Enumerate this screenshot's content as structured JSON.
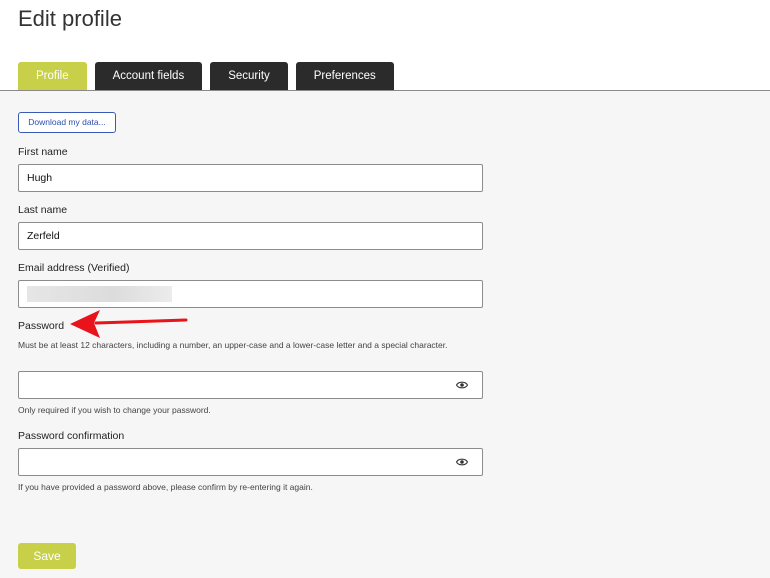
{
  "page": {
    "title": "Edit profile"
  },
  "tabs": [
    {
      "label": "Profile",
      "active": true
    },
    {
      "label": "Account fields",
      "active": false
    },
    {
      "label": "Security",
      "active": false
    },
    {
      "label": "Preferences",
      "active": false
    }
  ],
  "download_button": {
    "label": "Download my data..."
  },
  "fields": {
    "first_name": {
      "label": "First name",
      "value": "Hugh"
    },
    "last_name": {
      "label": "Last name",
      "value": "Zerfeld"
    },
    "email": {
      "label": "Email address (Verified)",
      "value": ""
    },
    "password": {
      "label": "Password",
      "requirements": "Must be at least 12 characters, including a number, an upper-case and a lower-case letter and a special character.",
      "value": "",
      "help": "Only required if you wish to change your password."
    },
    "password_confirmation": {
      "label": "Password confirmation",
      "value": "",
      "help": "If you have provided a password above, please confirm by re-entering it again."
    }
  },
  "save_button": {
    "label": "Save"
  },
  "icons": {
    "password_toggle": "eye-icon",
    "annotation": "red-arrow-annotation"
  },
  "colors": {
    "accent": "#c8d04a",
    "tab_inactive": "#2b2b2b",
    "link_blue": "#2a4fb0",
    "annotation_red": "#e8131b",
    "panel_bg": "#f6f6f6"
  }
}
